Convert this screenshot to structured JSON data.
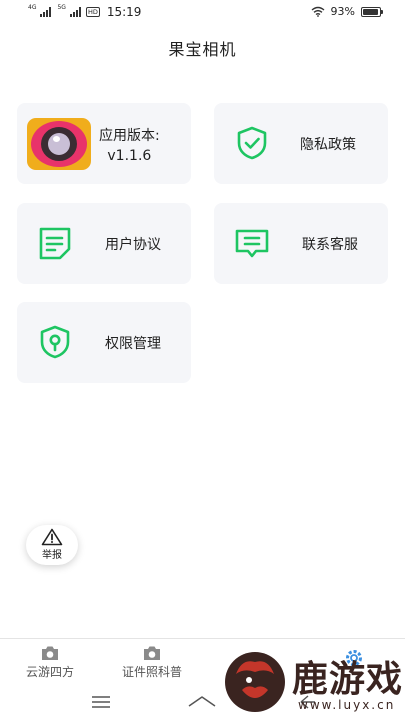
{
  "status_bar": {
    "sim1_label": "4G",
    "sim2_label": "5G",
    "hd_label": "HD",
    "time": "15:19",
    "battery": "93%",
    "battery_level": 0.93
  },
  "page": {
    "title": "果宝相机"
  },
  "cards": {
    "version": {
      "label": "应用版本:",
      "value": "v1.1.6"
    },
    "privacy": {
      "label": "隐私政策",
      "icon": "shield-check-icon"
    },
    "user_agreement": {
      "label": "用户协议",
      "icon": "document-icon"
    },
    "contact": {
      "label": "联系客服",
      "icon": "chat-bubble-icon"
    },
    "permissions": {
      "label": "权限管理",
      "icon": "shield-keyhole-icon"
    }
  },
  "report": {
    "label": "举报",
    "icon": "warning-triangle-icon"
  },
  "bottom_nav": [
    {
      "label": "云游四方",
      "icon": "camera-icon"
    },
    {
      "label": "证件照科普",
      "icon": "camera-icon"
    }
  ],
  "watermark": {
    "title": "鹿游戏",
    "url": "www.luyx.cn"
  },
  "colors": {
    "accent_green": "#1ec562",
    "card_bg": "#f5f6f9"
  }
}
